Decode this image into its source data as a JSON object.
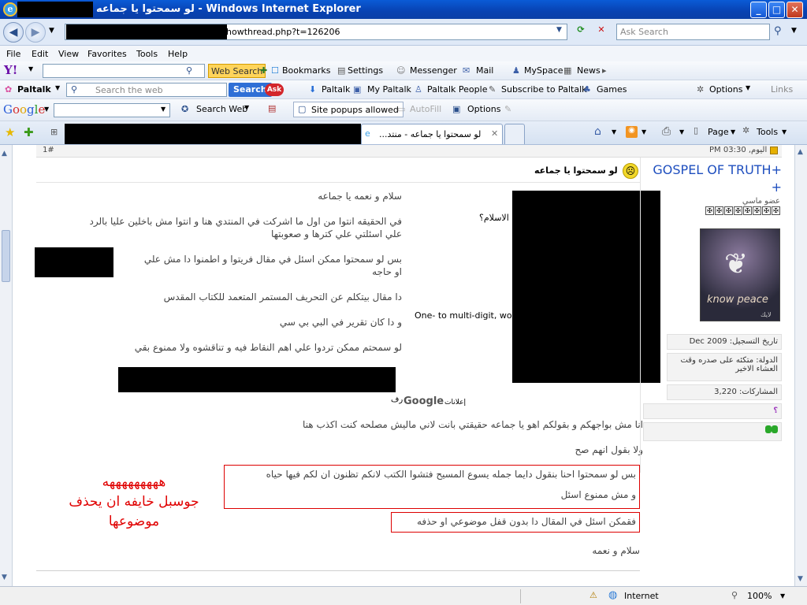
{
  "window": {
    "title": "لو سمحتوا يا جماعه - Windows Internet Explorer",
    "min": "_",
    "max": "□",
    "close": "✕"
  },
  "address": {
    "url_visible": "howthread.php?t=126206",
    "search_placeholder": "Ask Search"
  },
  "menu": [
    "File",
    "Edit",
    "View",
    "Favorites",
    "Tools",
    "Help"
  ],
  "yahoo_bar": {
    "logo": "Y!",
    "web_search": "Web Search",
    "items": [
      "Bookmarks",
      "Settings",
      "Messenger",
      "Mail",
      "MySpace",
      "News"
    ]
  },
  "paltalk_bar": {
    "logo": "Paltalk",
    "search_placeholder": "Search the web",
    "search_button": "Search",
    "ask_label": "Ask",
    "items": [
      "Paltalk",
      "My Paltalk",
      "Paltalk People",
      "Subscribe to Paltalk",
      "Games"
    ],
    "options": "Options",
    "links": "Links"
  },
  "google_bar": {
    "logo": "Google",
    "search_web": "Search Web",
    "popups": "Site popups allowed",
    "autofill": "AutoFill",
    "options": "Options"
  },
  "tabs": {
    "active_tab": "...لو سمحتوا يا جماعه - منتد",
    "page": "Page",
    "tools": "Tools"
  },
  "post": {
    "number": "1#",
    "time": "اليوم, 03:30 PM",
    "title": "لو سمحتوا يا جماعه",
    "lines": [
      "سلام و نعمه يا جماعه",
      "في الحقيقه انتوا من اول ما اشركت في المنتدي هنا و انتوا مش باخلين عليا بالرد",
      "علي اسئلتي علي كترها و صعوبتها",
      "بس لو سمحتوا ممكن اسئل في مقال فريتوا و اطمنوا دا مش علي",
      "او حاجه",
      "دا مقال بيتكلم عن التحريف المستمر المتعمد للكتاب المقدس",
      "و دا كان تقرير في البي بي سي",
      "لو سمحتم ممكن تردوا علي اهم النقاط فيه و تناقشوه ولا ممنوع بقي",
      "انا مش بواجهكم و بقولكم اهو يا جماعه حقيقتي بانت لاني ماليش مصلحه كنت اكذب هنا",
      "ولا بقول انهم صح"
    ],
    "box1_line1": "بس لو سمحتوا احنا بنقول دايما جمله يسوع المسيح فتشوا الكتب لانكم تظنون ان لكم فيها حياه",
    "box1_line2": "و مش ممنوع اسئل",
    "box2": "فقمكن اسئل في المقال دا بدون قفل موضوعي او حذفه",
    "closing": "سلام و نعمه"
  },
  "ad": {
    "q": "الاسلام؟",
    "snippet": "One- to multi-digit, wo",
    "footer_text": "إعلانات",
    "google": "Google",
    "suffix": "رف"
  },
  "annotation": {
    "line1": "هههههههههه",
    "line2": "جوسبل خايفه ان يحذف",
    "line3": "موضوعها",
    "color": "#e00000"
  },
  "author": {
    "name": "GOSPEL OF TRUTH+",
    "plus": "+",
    "rank": "عضو ماسي",
    "avatar_caption": "know peace",
    "avatar_small": "لايك",
    "joined": "تاريخ التسجيل: Dec 2009",
    "country_l1": "الدولة: متكئه على صدره وقت",
    "country_l2": "العشاء الاخير",
    "posts": "المشاركات: 3,220",
    "q_icon": "؟"
  },
  "status": {
    "zone": "Internet",
    "zoom": "100%"
  },
  "colors": {
    "accent": "#0a4fc4",
    "author_name": "#1f4fbf",
    "redbox": "#dd0000"
  }
}
